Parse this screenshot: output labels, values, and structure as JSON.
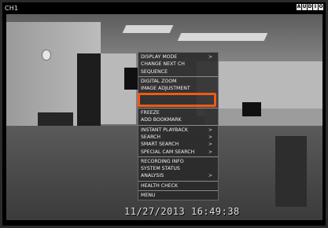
{
  "osd": {
    "channel": "CH1",
    "indicators": [
      "A",
      "U",
      "D",
      "I",
      "O"
    ],
    "timestamp": "11/27/2013 16:49:38"
  },
  "menu": {
    "items": [
      {
        "label": "DISPLAY MODE",
        "submenu": true
      },
      {
        "label": "CHANGE NEXT CH",
        "submenu": false
      },
      {
        "label": "SEQUENCE",
        "submenu": false
      },
      {
        "label": "DIGITAL ZOOM",
        "submenu": false
      },
      {
        "label": "IMAGE ADJUSTMENT",
        "submenu": false
      },
      {
        "label": "",
        "submenu": false
      },
      {
        "label": "",
        "submenu": false
      },
      {
        "label": "FREEZE",
        "submenu": false
      },
      {
        "label": "ADD BOOKMARK",
        "submenu": false
      },
      {
        "label": "INSTANT PLAYBACK",
        "submenu": true
      },
      {
        "label": "SEARCH",
        "submenu": true
      },
      {
        "label": "SMART SEARCH",
        "submenu": true
      },
      {
        "label": "SPECIAL CAM SEARCH",
        "submenu": true
      },
      {
        "label": "RECORDING INFO",
        "submenu": false
      },
      {
        "label": "SYSTEM STATUS",
        "submenu": false
      },
      {
        "label": "ANALYSIS",
        "submenu": true
      },
      {
        "label": "HEALTH CHECK",
        "submenu": false
      },
      {
        "label": "MENU",
        "submenu": false
      }
    ],
    "arrow_glyph": ">",
    "highlight_color": "#f05a14"
  }
}
